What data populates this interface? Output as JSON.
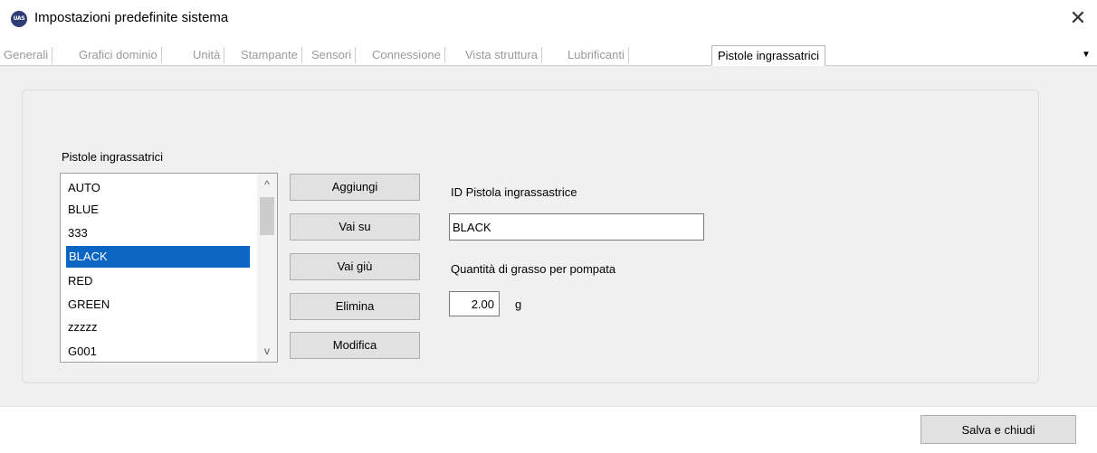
{
  "window": {
    "title": "Impostazioni predefinite sistema",
    "app_icon_text": "UAS",
    "app_icon_name": "uas-app-icon",
    "close_glyph": "✕"
  },
  "tabs": [
    {
      "label": "Generali"
    },
    {
      "label": "Grafici dominio"
    },
    {
      "label": "Unità"
    },
    {
      "label": "Stampante"
    },
    {
      "label": "Sensori"
    },
    {
      "label": "Connessione"
    },
    {
      "label": "Vista struttura"
    },
    {
      "label": "Lubrificanti"
    },
    {
      "label": "Pistole ingrassatrici",
      "active": true
    }
  ],
  "tab_overflow_glyph": "▼",
  "panel": {
    "list_label": "Pistole ingrassatrici",
    "list_items": [
      "AUTO",
      "BLUE",
      "333",
      "BLACK",
      "RED",
      "GREEN",
      "zzzzz",
      "G001"
    ],
    "selected_item": "BLACK",
    "scroll_up_glyph": "^",
    "scroll_down_glyph": "v",
    "buttons": {
      "add": "Aggiungi",
      "move_up": "Vai su",
      "move_down": "Vai giù",
      "delete": "Elimina",
      "edit": "Modifica"
    },
    "id_label": "ID Pistola ingrassastrice",
    "id_value": "BLACK",
    "quantity_label": "Quantità di grasso per pompata",
    "quantity_value": "2.00",
    "quantity_unit": "g"
  },
  "footer": {
    "save_close": "Salva e chiudi"
  },
  "colors": {
    "selection": "#0b65c3",
    "panel_background": "#f0f0f0",
    "button_face": "#e1e1e1"
  }
}
